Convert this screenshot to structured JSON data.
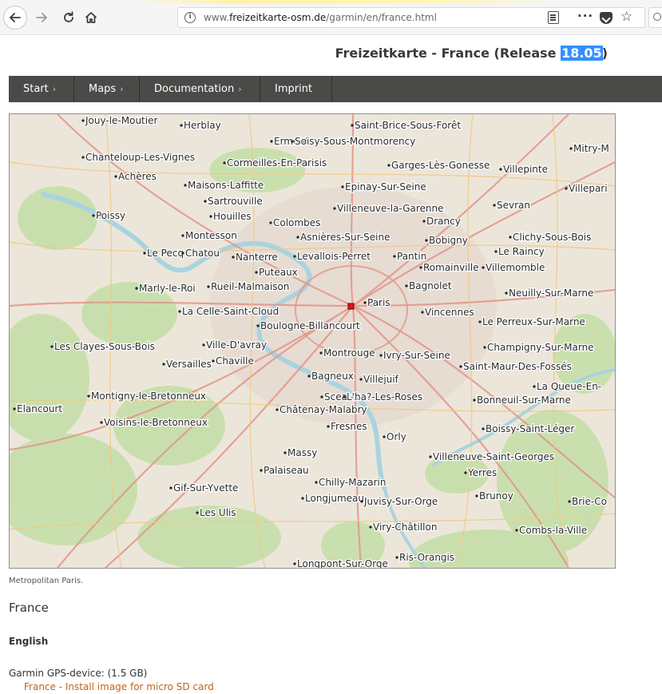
{
  "browser": {
    "url_prefix": "www.",
    "url_domain": "freizeitkarte-osm.de",
    "url_path": "/garmin/en/france.html"
  },
  "page": {
    "title_prefix": "Freizeitkarte - France (Release ",
    "title_selected": "18.05",
    "title_suffix": ")"
  },
  "menu": [
    {
      "label": "Start",
      "has_arrow": true
    },
    {
      "label": "Maps",
      "has_arrow": true
    },
    {
      "label": "Documentation",
      "has_arrow": true
    },
    {
      "label": "Imprint",
      "has_arrow": false
    }
  ],
  "menu_arrow": "›",
  "map": {
    "places": [
      "Jouy-le-Moutier",
      "Herblay",
      "Saint-Brice-Sous-Forêt",
      "Ermont",
      "Soisy-Sous-Montmorency",
      "Mitry-M",
      "Chanteloup-Les-Vignes",
      "Cormeilles-En-Parisis",
      "Garges-Lès-Gonesse",
      "Villepinte",
      "Achères",
      "Maisons-Laffitte",
      "Epinay-Sur-Seine",
      "Villepari",
      "Sartrouville",
      "Villeneuve-la-Garenne",
      "Sevran",
      "Poissy",
      "Houilles",
      "Colombes",
      "Drancy",
      "Montesson",
      "Asnières-Sur-Seine",
      "Bobigny",
      "Clichy-Sous-Bois",
      "Le Pecq",
      "Chatou",
      "Nanterre",
      "Levallois-Perret",
      "Pantin",
      "Le Raincy",
      "Puteaux",
      "Romainville",
      "Villemomble",
      "Marly-le-Roi",
      "Rueil-Malmaison",
      "Bagnolet",
      "Neuilly-Sur-Marne",
      "Paris",
      "La Celle-Saint-Cloud",
      "Vincennes",
      "Le Perreux-Sur-Marne",
      "Boulogne-Billancourt",
      "Les Clayes-Sous-Bois",
      "Ville-D'avray",
      "Montrouge",
      "Ivry-Sur-Seine",
      "Champigny-Sur-Marne",
      "Versailles",
      "Chaville",
      "Saint-Maur-Des-Fossés",
      "Bagneux",
      "Villejuif",
      "La Queue-En-",
      "Montigny-le-Bretonneux",
      "Sceaux",
      "L'ha?-Les-Roses",
      "Bonneuil-Sur-Marne",
      "Elancourt",
      "Châtenay-Malabry",
      "Voisins-le-Bretonneux",
      "Fresnes",
      "Orly",
      "Boissy-Saint-Léger",
      "Massy",
      "Villeneuve-Saint-Georges",
      "Palaiseau",
      "Yerres",
      "Chilly-Mazarin",
      "Gif-Sur-Yvette",
      "Brunoy",
      "Longjumeau",
      "Juvisy-Sur-Orge",
      "Brie-Co",
      "Les Ulis",
      "Viry-Châtillon",
      "Combs-la-Ville",
      "Ris-Orangis",
      "Longpont-Sur-Orge"
    ]
  },
  "content": {
    "caption": "Metropolitan Paris.",
    "heading": "France",
    "language": "English",
    "device_line": "Garmin GPS-device: (1.5 GB)",
    "download_link": "France - Install image for micro SD card"
  }
}
